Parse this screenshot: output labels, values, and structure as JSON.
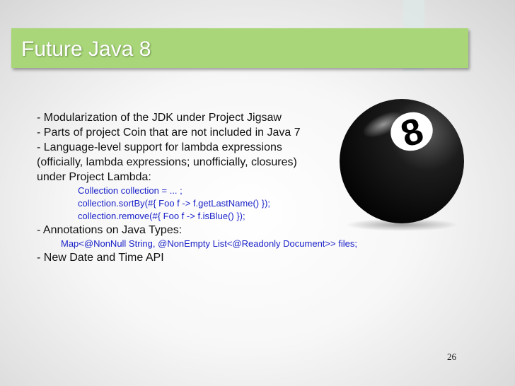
{
  "slide": {
    "title": "Future Java 8",
    "page_number": "26",
    "colors": {
      "title_bar": "#a8d678",
      "code_text": "#1a22c8"
    },
    "lines": [
      {
        "kind": "text",
        "text": "- Modularization of the JDK under Project Jigsaw"
      },
      {
        "kind": "text",
        "text": "- Parts of project Coin that are not included in Java 7"
      },
      {
        "kind": "text",
        "text": "- Language-level support for lambda expressions"
      },
      {
        "kind": "text",
        "text": "(officially, lambda expressions; unofficially, closures)"
      },
      {
        "kind": "text",
        "text": "under Project Lambda:"
      },
      {
        "kind": "code1",
        "text": "Collection collection = ... ;"
      },
      {
        "kind": "code1",
        "text": "collection.sortBy(#{ Foo f -> f.getLastName() });"
      },
      {
        "kind": "code1",
        "text": "collection.remove(#{ Foo f -> f.isBlue() });"
      },
      {
        "kind": "text",
        "text": "- Annotations on Java Types:"
      },
      {
        "kind": "code2",
        "text": "Map<@NonNull String, @NonEmpty List<@Readonly Document>> files;"
      },
      {
        "kind": "text",
        "text": "- New Date and Time API"
      }
    ],
    "ball": {
      "label": "8",
      "icon": "eight-ball-icon"
    }
  }
}
